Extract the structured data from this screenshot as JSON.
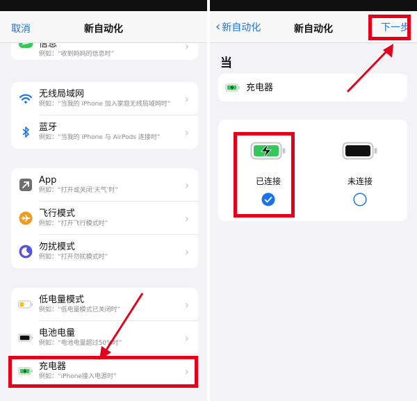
{
  "left": {
    "nav": {
      "cancel": "取消",
      "title": "新自动化"
    },
    "groups": [
      {
        "items": [
          {
            "icon": "message-icon",
            "title": "信息",
            "sub": "例如：“收到妈妈的信息时”"
          }
        ]
      },
      {
        "items": [
          {
            "icon": "wifi-icon",
            "title": "无线局域网",
            "sub": "例如：“当我的 iPhone 加入家庭无线局域网时”"
          },
          {
            "icon": "bluetooth-icon",
            "title": "蓝牙",
            "sub": "例如：“当我的 iPhone 与 AirPods 连接时”"
          }
        ]
      },
      {
        "items": [
          {
            "icon": "app-icon",
            "title": "App",
            "sub": "例如：“打开或关闭‘天气’时”"
          },
          {
            "icon": "airplane-icon",
            "title": "飞行模式",
            "sub": "例如：“打开飞行模式时”"
          },
          {
            "icon": "moon-icon",
            "title": "勿扰模式",
            "sub": "例如：“打开勿扰模式时”"
          }
        ]
      },
      {
        "items": [
          {
            "icon": "low-battery-icon",
            "title": "低电量模式",
            "sub": "例如：“低电量模式已关闭时”"
          },
          {
            "icon": "battery-level-icon",
            "title": "电池电量",
            "sub": "例如：“电池电量超过50%时”"
          },
          {
            "icon": "charger-icon",
            "title": "充电器",
            "sub": "例如：“iPhone接入电源时”"
          }
        ]
      }
    ]
  },
  "right": {
    "nav": {
      "back": "新自动化",
      "title": "新自动化",
      "next": "下一步"
    },
    "section": "当",
    "trigger": "充电器",
    "options": [
      {
        "label": "已连接",
        "selected": true
      },
      {
        "label": "未连接",
        "selected": false
      }
    ]
  },
  "colors": {
    "accent": "#1a73e8",
    "highlight": "#e3001b",
    "charging": "#34c759",
    "low": "#f5c400"
  }
}
